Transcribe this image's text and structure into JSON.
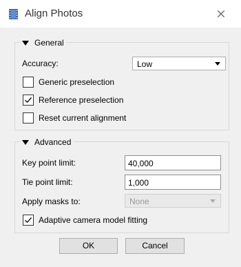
{
  "window": {
    "title": "Align Photos",
    "close_glyph": "×"
  },
  "general": {
    "title": "General",
    "accuracy_label": "Accuracy:",
    "accuracy_value": "Low",
    "generic_preselection": {
      "label": "Generic preselection",
      "checked": false
    },
    "reference_preselection": {
      "label": "Reference preselection",
      "checked": true
    },
    "reset_alignment": {
      "label": "Reset current alignment",
      "checked": false
    }
  },
  "advanced": {
    "title": "Advanced",
    "key_point_label": "Key point limit:",
    "key_point_value": "40,000",
    "tie_point_label": "Tie point limit:",
    "tie_point_value": "1,000",
    "masks_label": "Apply masks to:",
    "masks_value": "None",
    "adaptive_fitting": {
      "label": "Adaptive camera model fitting",
      "checked": true
    }
  },
  "buttons": {
    "ok": "OK",
    "cancel": "Cancel"
  },
  "icons": {
    "app": "film-strip-icon",
    "close": "close-icon",
    "collapse": "triangle-down-icon",
    "check": "checkmark-icon",
    "dropdown": "chevron-down-icon"
  },
  "colors": {
    "app_icon": "#3f6bb2",
    "dialog_bg": "#f0f0f0"
  }
}
